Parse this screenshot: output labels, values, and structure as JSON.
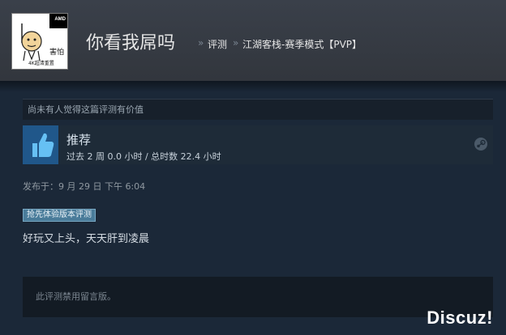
{
  "header": {
    "username": "你看我屌吗",
    "breadcrumb_sep": "»",
    "breadcrumb_reviews": "评测",
    "breadcrumb_game": "江湖客栈-赛季模式【PVP】"
  },
  "avatar": {
    "badge_text": "AMD",
    "caption_line1": "害怕",
    "caption_line2": "4K超清重置"
  },
  "review": {
    "helpful_text": "尚未有人觉得这篇评测有价值",
    "recommendation": "推荐",
    "hours_text": "过去 2 周 0.0 小时 / 总时数 22.4 小时",
    "posted_text": "发布于：9 月 29 日 下午 6:04",
    "early_access_badge": "抢先体验版本评测",
    "body": "好玩又上头，天天肝到凌晨",
    "comments_disabled": "此评测禁用留言版。"
  },
  "watermark": "Discuz!",
  "colors": {
    "page_bg": "#1b2838",
    "header_bg": "#3a404a",
    "thumb_bg": "#20578a",
    "badge_bg": "#4a7c9a"
  },
  "icons": {
    "thumb": "thumbs-up-icon",
    "platform": "steam-icon"
  }
}
